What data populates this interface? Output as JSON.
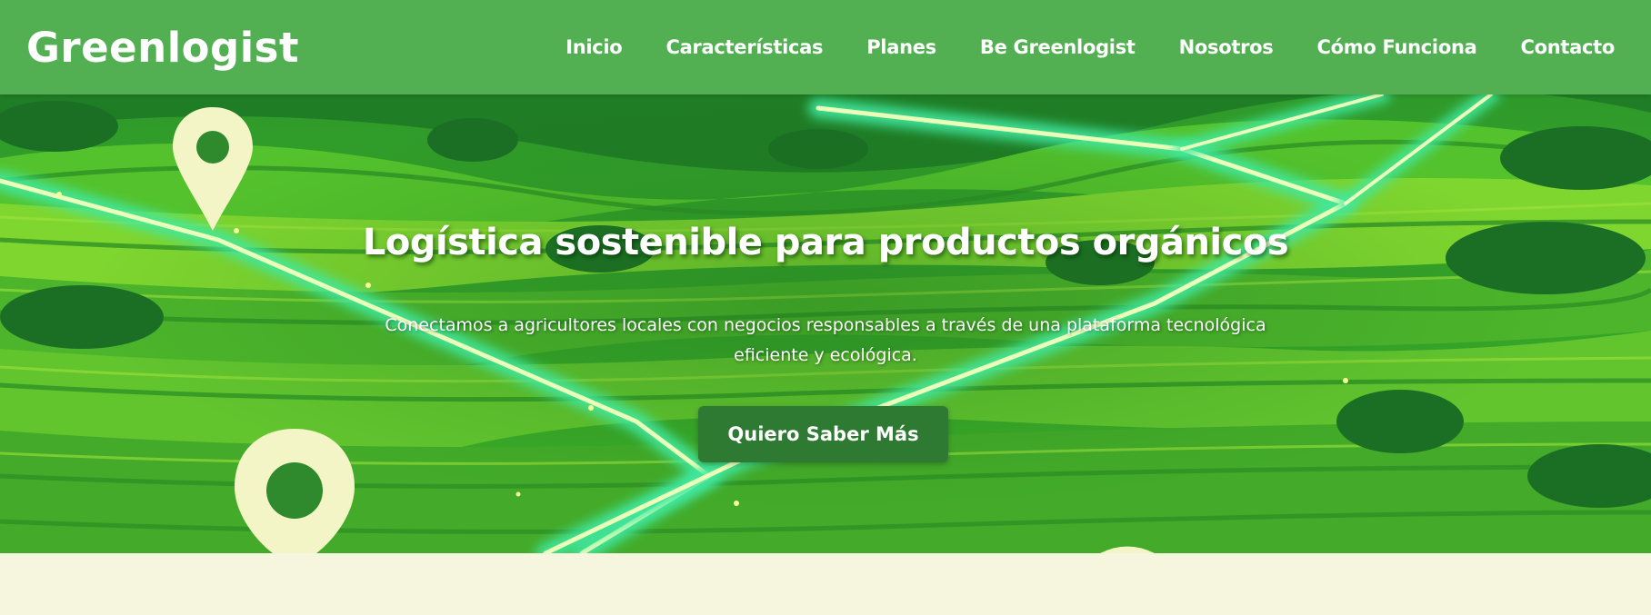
{
  "header": {
    "logo": "Greenlogist",
    "nav": [
      {
        "label": "Inicio"
      },
      {
        "label": "Características"
      },
      {
        "label": "Planes"
      },
      {
        "label": "Be Greenlogist"
      },
      {
        "label": "Nosotros"
      },
      {
        "label": "Cómo Funciona"
      },
      {
        "label": "Contacto"
      }
    ]
  },
  "hero": {
    "title": "Logística sostenible para productos orgánicos",
    "subtitle": "Conectamos a agricultores locales con negocios responsables a través de una plataforma tecnológica eficiente y ecológica.",
    "cta_label": "Quiero Saber Más"
  },
  "colors": {
    "nav_bg": "#52b052",
    "button_bg": "#2f7a33",
    "page_bg": "#f6f6df",
    "field_green": "#3fae2a",
    "road_glow": "#3fe8a0",
    "pin": "#f4f5c6"
  },
  "icons": [
    "location-pin-icon",
    "location-pin-icon",
    "location-pin-icon"
  ]
}
